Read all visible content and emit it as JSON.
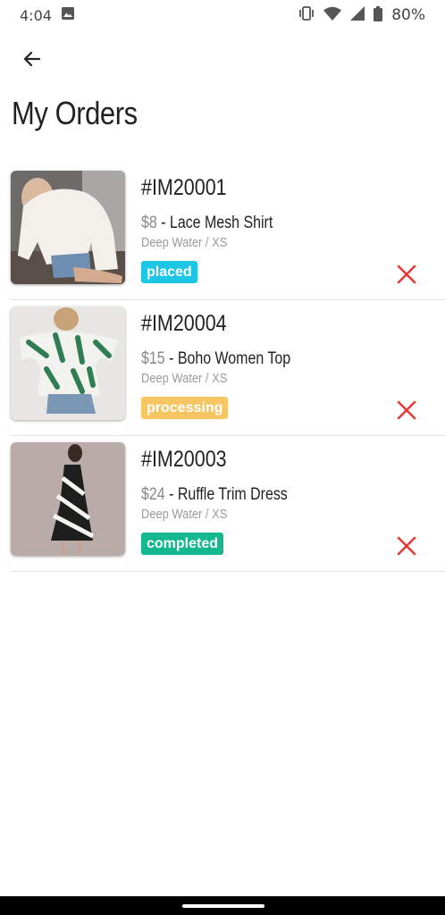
{
  "status_bar": {
    "time": "4:04",
    "battery": "80%",
    "icons": [
      "image-icon",
      "vibrate-icon",
      "wifi-icon",
      "signal-icon",
      "battery-icon"
    ]
  },
  "header": {
    "back_icon": "arrow-left-icon",
    "title": "My Orders"
  },
  "orders": [
    {
      "id": "#IM20001",
      "price": "$8",
      "separator": " - ",
      "name": "Lace Mesh Shirt",
      "variant": "Deep Water / XS",
      "status": "placed",
      "status_color": "#1ec6e6"
    },
    {
      "id": "#IM20004",
      "price": "$15",
      "separator": " - ",
      "name": "Boho Women Top",
      "variant": "Deep Water / XS",
      "status": "processing",
      "status_color": "#f7c562"
    },
    {
      "id": "#IM20003",
      "price": "$24",
      "separator": " - ",
      "name": "Ruffle Trim Dress",
      "variant": "Deep Water / XS",
      "status": "completed",
      "status_color": "#14b88e"
    }
  ],
  "colors": {
    "cancel": "#e53935",
    "divider": "#e3e3e3"
  }
}
